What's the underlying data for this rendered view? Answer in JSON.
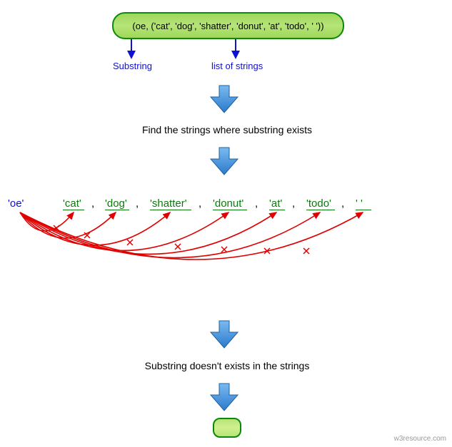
{
  "input_box": "(oe, ('cat', 'dog', 'shatter', 'donut', 'at', 'todo', '  '))",
  "labels": {
    "substring": "Substring",
    "list": "list of strings"
  },
  "step1": "Find the strings where substring exists",
  "substring_value": "'oe'",
  "strings": [
    "'cat'",
    "'dog'",
    "'shatter'",
    "'donut'",
    "'at'",
    "'todo'",
    "'  '"
  ],
  "step2": "Substring doesn't exists in the strings",
  "watermark": "w3resource.com"
}
